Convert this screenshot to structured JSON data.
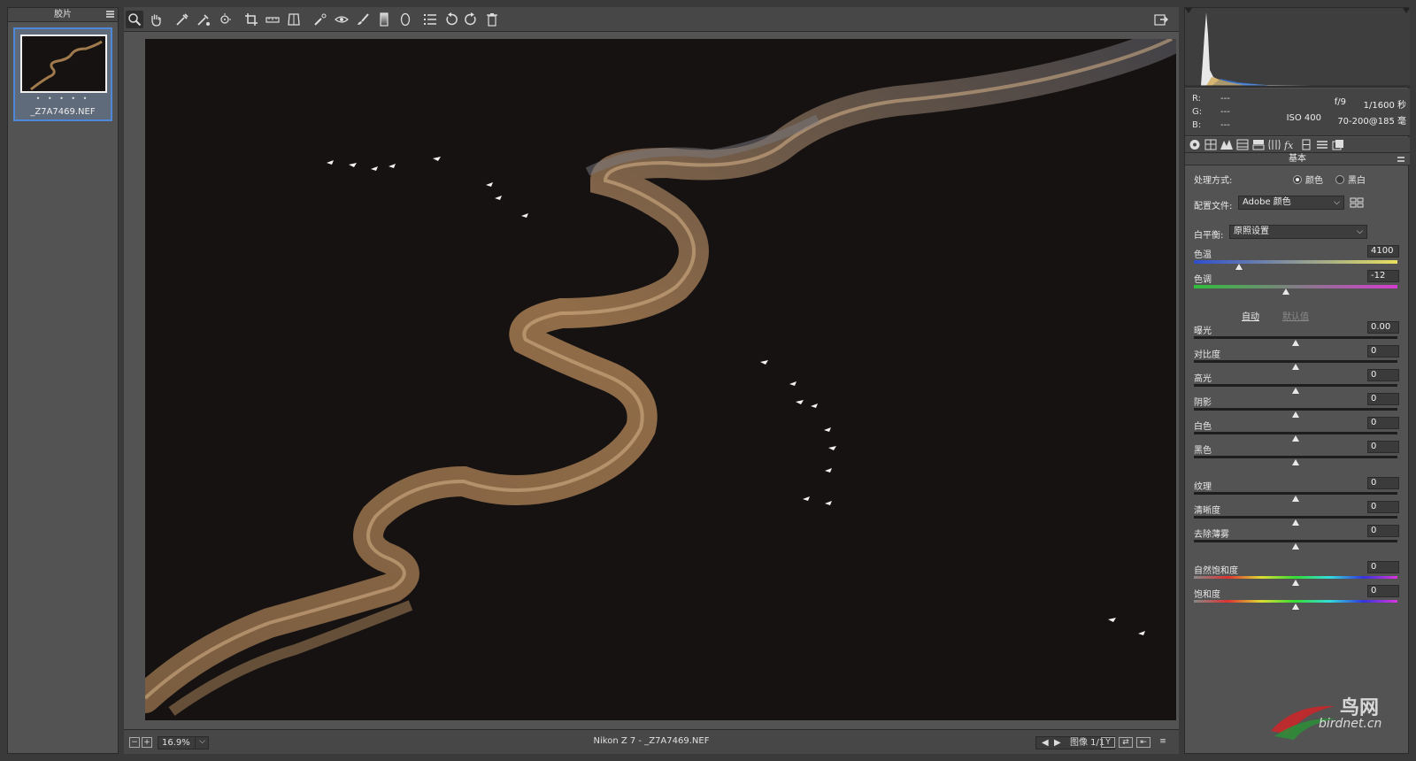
{
  "filmstrip": {
    "title": "胶片",
    "thumbnail": {
      "rating_stars": "• • • • •",
      "filename": "_Z7A7469.NEF"
    }
  },
  "toolbar": {
    "tools": [
      "zoom-tool",
      "hand-tool",
      "white-balance-tool",
      "color-sampler-tool",
      "targeted-adjustment-tool",
      "crop-tool",
      "straighten-tool",
      "transform-tool",
      "spot-removal-tool",
      "red-eye-tool",
      "adjustment-brush-tool",
      "graduated-filter-tool",
      "radial-filter-tool",
      "preferences",
      "rotate-left",
      "rotate-right",
      "delete"
    ],
    "active_tool": "zoom-tool"
  },
  "statusbar": {
    "zoom": "16.9%",
    "title": "Nikon Z 7 - _Z7A7469.NEF",
    "image_counter": "图像 1/1"
  },
  "histogram": {
    "readout": {
      "r_label": "R:",
      "g_label": "G:",
      "b_label": "B:",
      "r_value": "---",
      "g_value": "---",
      "b_value": "---"
    },
    "exif": {
      "aperture": "f/9",
      "shutter": "1/1600 秒",
      "iso": "ISO 400",
      "lens": "70-200@185 毫"
    }
  },
  "panel": {
    "section_title": "基本",
    "treatment_label": "处理方式:",
    "treatment_color": "颜色",
    "treatment_bw": "黑白",
    "treatment_selected": "color",
    "profile_label": "配置文件:",
    "profile_value": "Adobe 颜色",
    "wb_label": "白平衡:",
    "wb_value": "原照设置",
    "auto_label": "自动",
    "default_label": "默认值",
    "sliders": [
      {
        "name": "色温",
        "value": "4100",
        "position": 0.22,
        "track": "temp"
      },
      {
        "name": "色调",
        "value": "-12",
        "position": 0.45,
        "track": "tint"
      },
      {
        "name": "曝光",
        "value": "0.00",
        "position": 0.5,
        "track": "plain"
      },
      {
        "name": "对比度",
        "value": "0",
        "position": 0.5,
        "track": "plain"
      },
      {
        "name": "高光",
        "value": "0",
        "position": 0.5,
        "track": "plain"
      },
      {
        "name": "阴影",
        "value": "0",
        "position": 0.5,
        "track": "plain"
      },
      {
        "name": "白色",
        "value": "0",
        "position": 0.5,
        "track": "plain"
      },
      {
        "name": "黑色",
        "value": "0",
        "position": 0.5,
        "track": "plain"
      },
      {
        "name": "纹理",
        "value": "0",
        "position": 0.5,
        "track": "plain"
      },
      {
        "name": "清晰度",
        "value": "0",
        "position": 0.5,
        "track": "plain"
      },
      {
        "name": "去除薄雾",
        "value": "0",
        "position": 0.5,
        "track": "plain"
      },
      {
        "name": "自然饱和度",
        "value": "0",
        "position": 0.5,
        "track": "sat"
      },
      {
        "name": "饱和度",
        "value": "0",
        "position": 0.5,
        "track": "sat"
      }
    ]
  },
  "watermark": {
    "cn": "鸟网",
    "en": "birdnet.cn"
  },
  "colors": {
    "accent": "#4e88d8",
    "panel": "#535353",
    "photo_bg": "#161211"
  }
}
